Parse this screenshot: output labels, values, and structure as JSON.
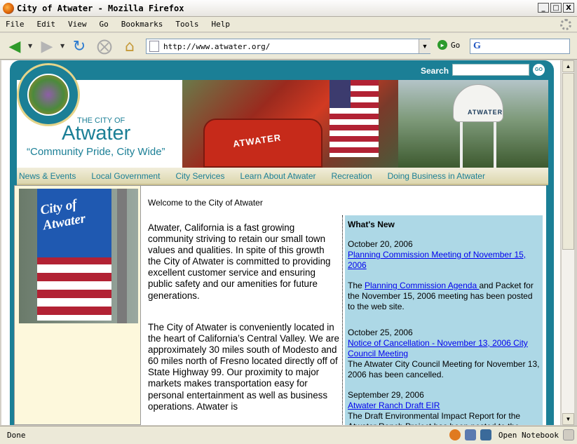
{
  "window": {
    "title": "City of Atwater - Mozilla Firefox",
    "min": "_",
    "max": "□",
    "close": "X"
  },
  "menu": [
    "File",
    "Edit",
    "View",
    "Go",
    "Bookmarks",
    "Tools",
    "Help"
  ],
  "toolbar": {
    "url": "http://www.atwater.org/",
    "go_label": "Go",
    "google_glyph": "G"
  },
  "status": {
    "text": "Done",
    "notebook": "Open Notebook"
  },
  "site": {
    "search_label": "Search",
    "search_go": "GO",
    "the_city_of": "THE CITY OF",
    "city_name": "Atwater",
    "tagline": "“Community Pride, City Wide”",
    "truck_text": "ATWATER",
    "tower_text": "ATWATER",
    "banner_text": "City of Atwater",
    "nav": [
      "News & Events",
      "Local Government",
      "City Services",
      "Learn About Atwater",
      "Recreation",
      "Doing Business in Atwater"
    ],
    "welcome": "Welcome to the City of Atwater",
    "para1": "Atwater, California is a fast growing community striving to retain our small town values and qualities.  In spite of this growth the City of Atwater is committed to providing excellent customer service and ensuring public safety and our amenities for future generations.",
    "para2": "The City of Atwater is conveniently located in the heart of California’s Central Valley.  We are approximately 30 miles south of Modesto and 60 miles north of Fresno located directly off of State Highway 99. Our proximity to major markets makes transportation easy for personal entertainment as well as business operations.  Atwater is"
  },
  "whats_new": {
    "heading": "What's New",
    "items": [
      {
        "date": "October 20, 2006",
        "link": "Planning Commission Meeting of November 15, 2006",
        "pre": "The ",
        "link2": "Planning Commission Agenda ",
        "post": "and Packet for the November 15, 2006 meeting has been posted to the web site."
      },
      {
        "date": "October 25, 2006",
        "link": "Notice of Cancellation - November 13, 2006 City Council Meeting",
        "post": "The Atwater City Council Meeting for November 13, 2006 has been cancelled."
      },
      {
        "date": "September 29, 2006",
        "link": "Atwater Ranch Draft EIR",
        "post": "The Draft Environmental Impact Report for the Atwater Ranch Project has been posted to the"
      }
    ]
  },
  "colors": {
    "teal": "#1b7f96",
    "news_bg": "#add8e6",
    "nav_text": "#1b7f96"
  }
}
